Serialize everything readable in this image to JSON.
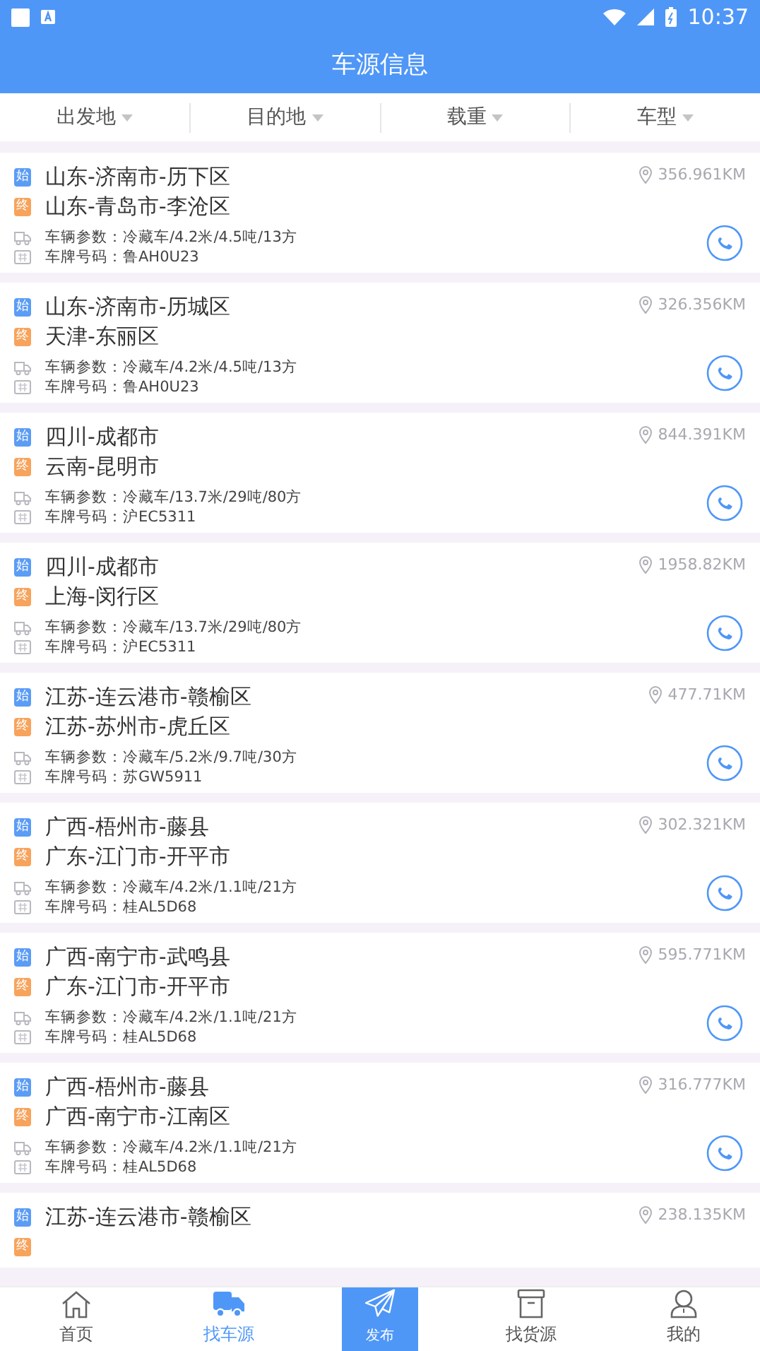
{
  "status_bar": {
    "time": "10:37"
  },
  "header": {
    "title": "车源信息"
  },
  "filters": [
    {
      "label": "出发地"
    },
    {
      "label": "目的地"
    },
    {
      "label": "载重"
    },
    {
      "label": "车型"
    }
  ],
  "cards": [
    {
      "start_badge": "始",
      "origin": "山东-济南市-历下区",
      "end_badge": "终",
      "destination": "山东-青岛市-李沧区",
      "distance": "356.961KM",
      "params": "车辆参数：冷藏车/4.2米/4.5吨/13方",
      "plate": "车牌号码：鲁AH0U23"
    },
    {
      "start_badge": "始",
      "origin": "山东-济南市-历城区",
      "end_badge": "终",
      "destination": "天津-东丽区",
      "distance": "326.356KM",
      "params": "车辆参数：冷藏车/4.2米/4.5吨/13方",
      "plate": "车牌号码：鲁AH0U23"
    },
    {
      "start_badge": "始",
      "origin": "四川-成都市",
      "end_badge": "终",
      "destination": "云南-昆明市",
      "distance": "844.391KM",
      "params": "车辆参数：冷藏车/13.7米/29吨/80方",
      "plate": "车牌号码：沪EC5311"
    },
    {
      "start_badge": "始",
      "origin": "四川-成都市",
      "end_badge": "终",
      "destination": "上海-闵行区",
      "distance": "1958.82KM",
      "params": "车辆参数：冷藏车/13.7米/29吨/80方",
      "plate": "车牌号码：沪EC5311"
    },
    {
      "start_badge": "始",
      "origin": "江苏-连云港市-赣榆区",
      "end_badge": "终",
      "destination": "江苏-苏州市-虎丘区",
      "distance": "477.71KM",
      "params": "车辆参数：冷藏车/5.2米/9.7吨/30方",
      "plate": "车牌号码：苏GW5911"
    },
    {
      "start_badge": "始",
      "origin": "广西-梧州市-藤县",
      "end_badge": "终",
      "destination": "广东-江门市-开平市",
      "distance": "302.321KM",
      "params": "车辆参数：冷藏车/4.2米/1.1吨/21方",
      "plate": "车牌号码：桂AL5D68"
    },
    {
      "start_badge": "始",
      "origin": "广西-南宁市-武鸣县",
      "end_badge": "终",
      "destination": "广东-江门市-开平市",
      "distance": "595.771KM",
      "params": "车辆参数：冷藏车/4.2米/1.1吨/21方",
      "plate": "车牌号码：桂AL5D68"
    },
    {
      "start_badge": "始",
      "origin": "广西-梧州市-藤县",
      "end_badge": "终",
      "destination": "广西-南宁市-江南区",
      "distance": "316.777KM",
      "params": "车辆参数：冷藏车/4.2米/1.1吨/21方",
      "plate": "车牌号码：桂AL5D68"
    },
    {
      "start_badge": "始",
      "origin": "江苏-连云港市-赣榆区",
      "end_badge": "终",
      "distance": "238.135KM"
    }
  ],
  "bottom_nav": [
    {
      "kind": "home",
      "label": "首页",
      "selected": false
    },
    {
      "kind": "truck",
      "label": "找车源",
      "selected": true
    },
    {
      "kind": "publish",
      "label": "发布",
      "selected": false
    },
    {
      "kind": "box",
      "label": "找货源",
      "selected": false
    },
    {
      "kind": "person",
      "label": "我的",
      "selected": false
    }
  ]
}
